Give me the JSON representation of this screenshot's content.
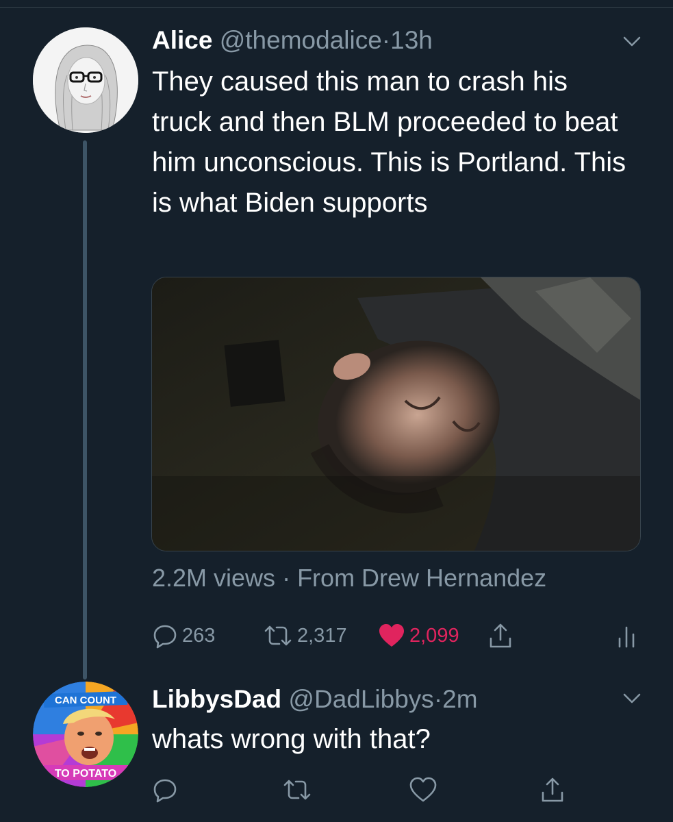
{
  "tweet1": {
    "display_name": "Alice",
    "handle": "@themodalice",
    "separator": "·",
    "time": "13h",
    "text": "They caused this man to crash his truck and then BLM proceeded to beat him unconscious. This is Portland. This is what Biden supports",
    "media_views": "2.2M views",
    "media_source": "From Drew Hernandez",
    "replies": "263",
    "retweets": "2,317",
    "likes": "2,099"
  },
  "tweet2": {
    "display_name": "LibbysDad",
    "handle": "@DadLibbys",
    "separator": "·",
    "time": "2m",
    "text": "whats wrong with that?",
    "avatar_text_top": "CAN COUNT",
    "avatar_text_bottom": "TO POTATO"
  },
  "colors": {
    "background": "#15202b",
    "secondary_text": "#8899a6",
    "like_red": "#e0245e",
    "thread_line": "#3d5466"
  },
  "icons": [
    "chevron-down-icon",
    "reply-icon",
    "retweet-icon",
    "heart-icon",
    "share-icon",
    "analytics-icon"
  ]
}
